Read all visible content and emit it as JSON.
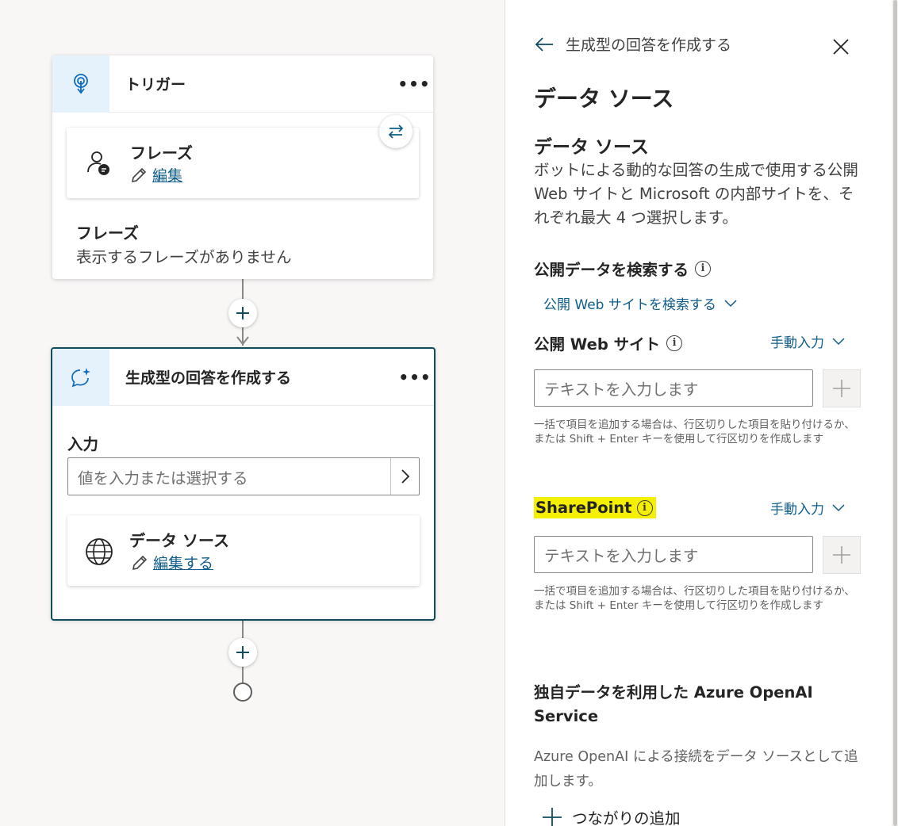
{
  "trigger_node": {
    "title": "トリガー",
    "more_label": "•••",
    "phrase_card": {
      "title": "フレーズ",
      "edit_label": "編集"
    },
    "phrases_heading": "フレーズ",
    "phrases_empty": "表示するフレーズがありません"
  },
  "answer_node": {
    "title": "生成型の回答を作成する",
    "more_label": "•••",
    "input_label": "入力",
    "input_placeholder": "値を入力または選択する",
    "datasource_card": {
      "title": "データ ソース",
      "edit_label": "編集する"
    }
  },
  "panel": {
    "back_title": "生成型の回答を作成する",
    "heading": "データ ソース",
    "subheading": "データ ソース",
    "description": "ボットによる動的な回答の生成で使用する公開 Web サイトと Microsoft の内部サイトを、それぞれ最大 4 つ選択します。",
    "public_search": {
      "label": "公開データを検索する",
      "dropdown": "公開 Web サイトを検索する"
    },
    "public_web": {
      "label": "公開 Web サイト",
      "mode": "手動入力",
      "placeholder": "テキストを入力します",
      "hint": "一括で項目を追加する場合は、行区切りした項目を貼り付けるか、または Shift + Enter キーを使用して行区切りを作成します"
    },
    "sharepoint": {
      "label": "SharePoint",
      "mode": "手動入力",
      "placeholder": "テキストを入力します",
      "hint": "一括で項目を追加する場合は、行区切りした項目を貼り付けるか、または Shift + Enter キーを使用して行区切りを作成します",
      "highlight_color": "#f5ef00"
    },
    "azure": {
      "heading": "独自データを利用した Azure OpenAI Service",
      "description": "Azure OpenAI による接続をデータ ソースとして追加します。",
      "add_label": "つながりの追加"
    }
  },
  "colors": {
    "accent": "#0f4c5c",
    "link": "#0f5d8a",
    "node_icon_bg": "#e5f1fb"
  }
}
